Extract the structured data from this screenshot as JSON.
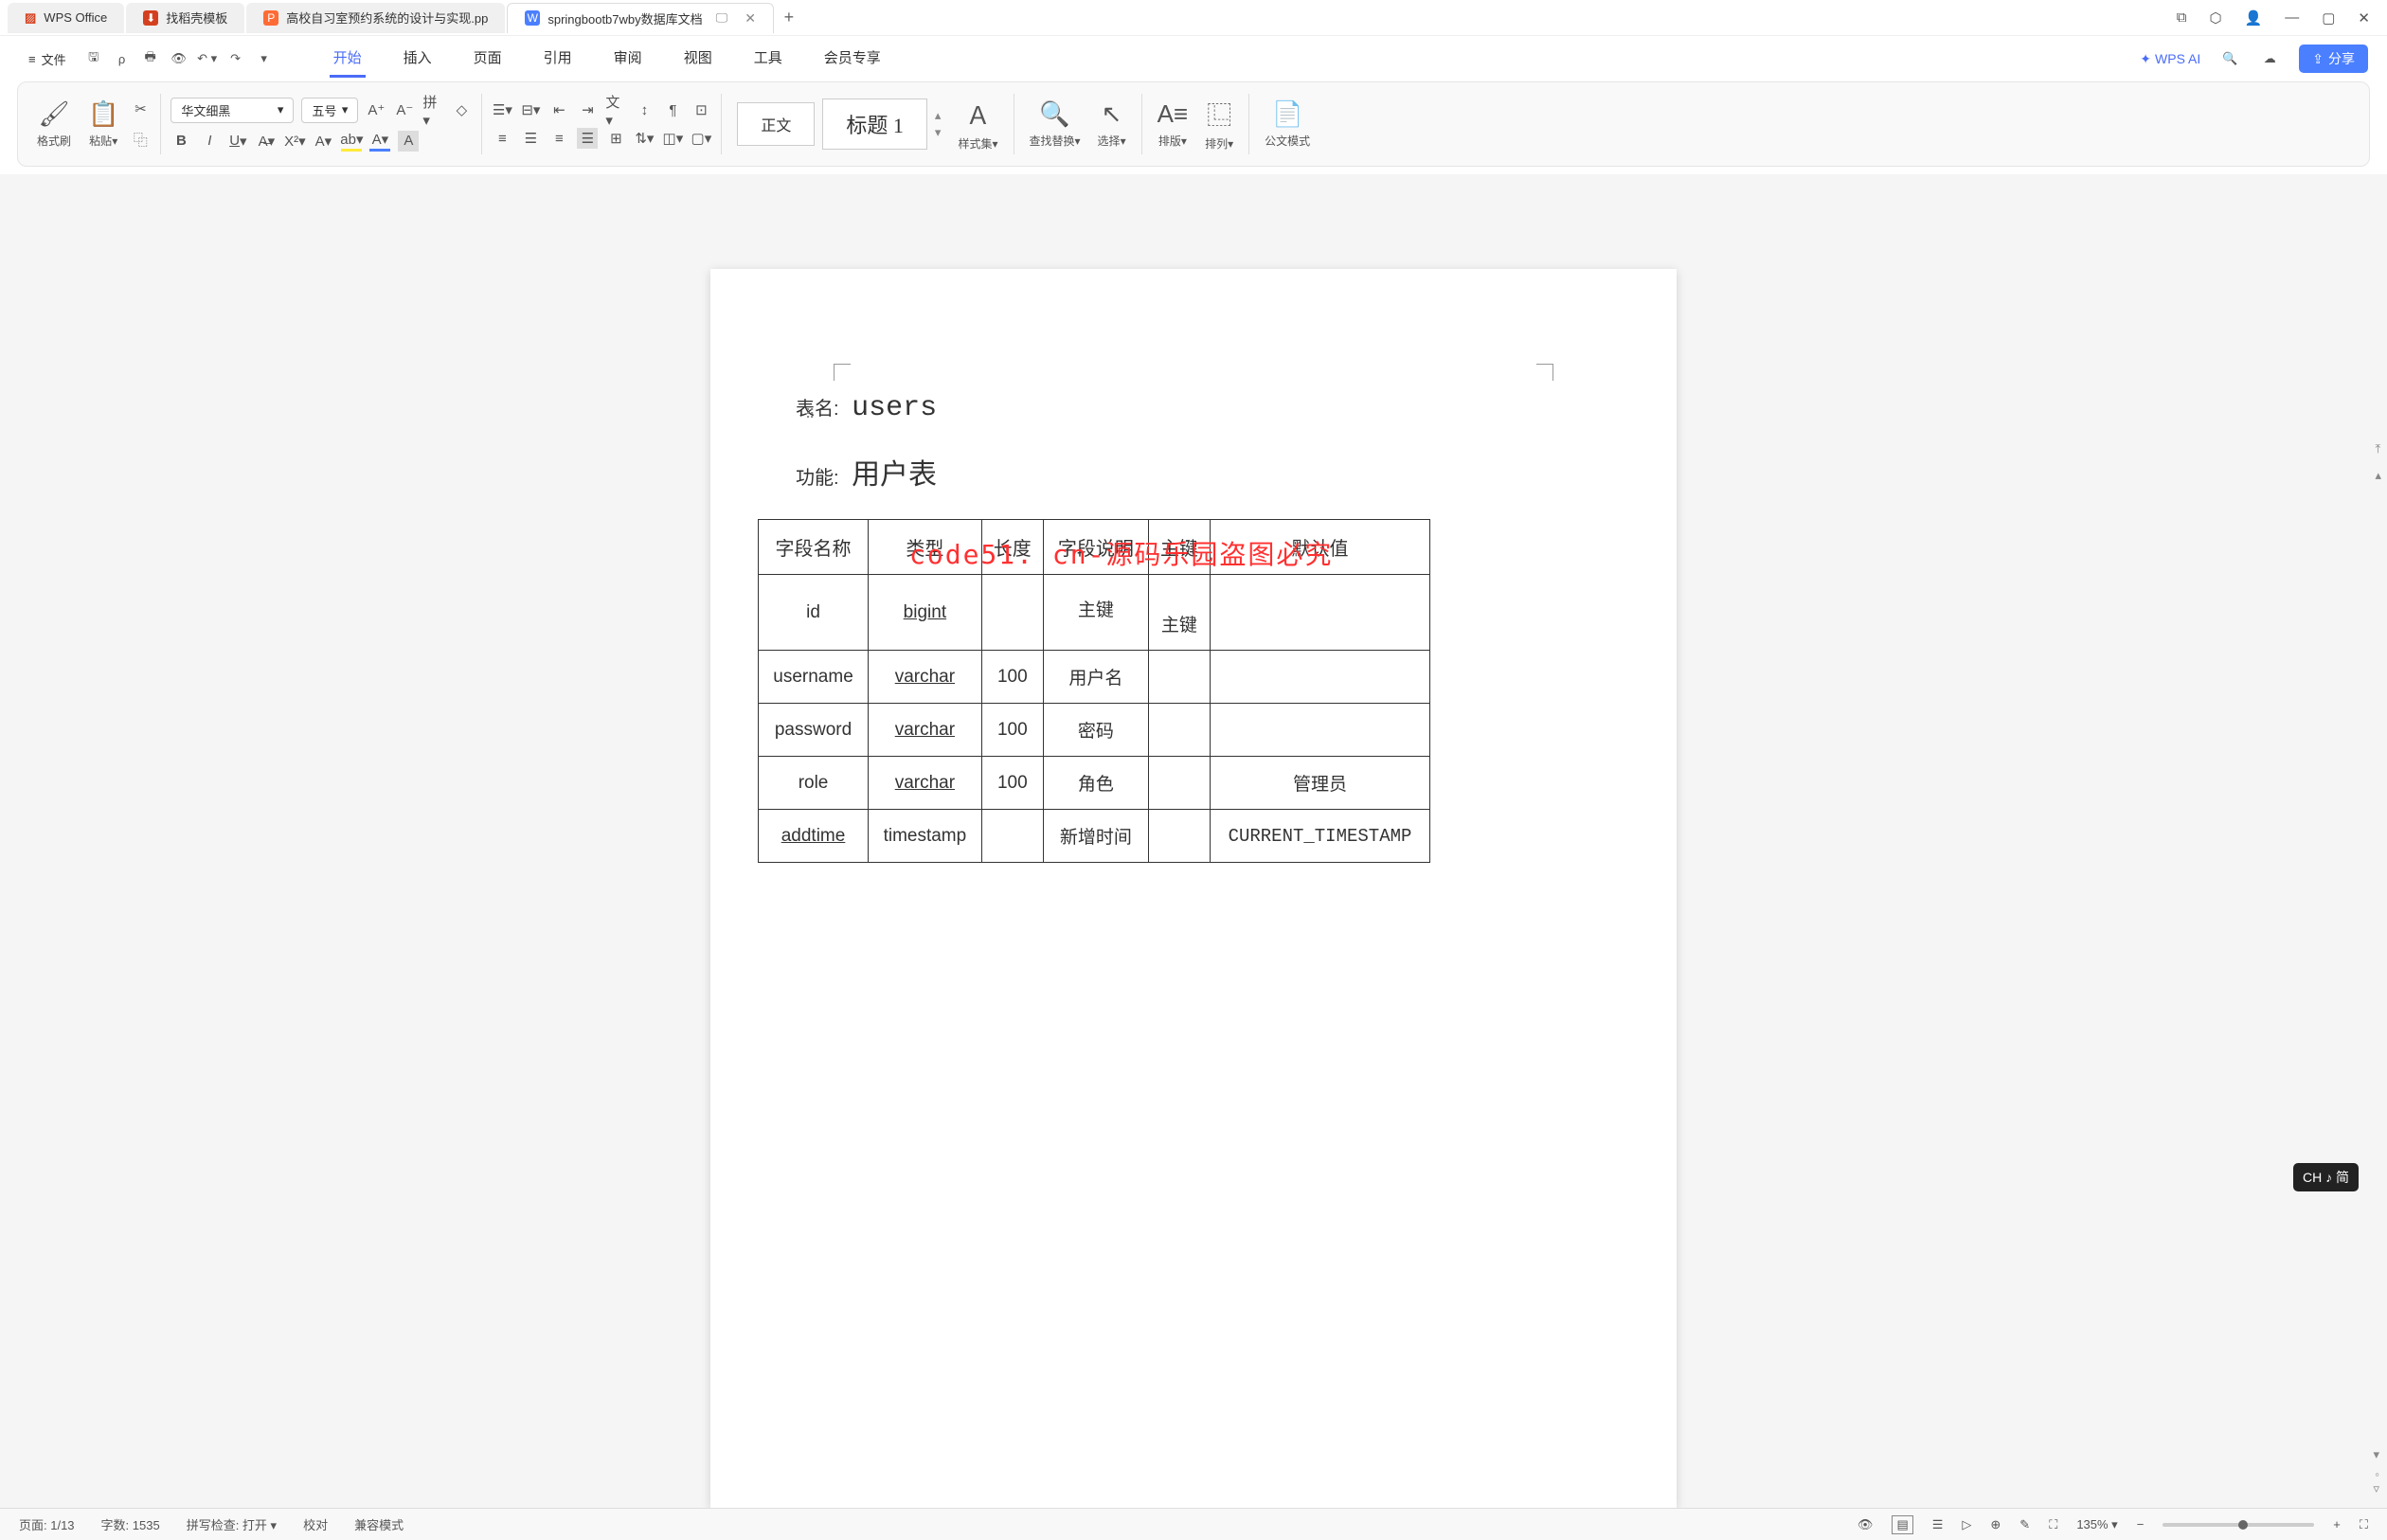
{
  "app_name": "WPS Office",
  "tabs": [
    {
      "label": "找稻壳模板",
      "icon_bg": "#d4401f"
    },
    {
      "label": "高校自习室预约系统的设计与实现.pp",
      "icon_bg": "#ff6b35",
      "icon_letter": "P"
    },
    {
      "label": "springbootb7wby数据库文档",
      "icon_bg": "#4a7fff",
      "icon_letter": "W",
      "active": true
    }
  ],
  "menubar": {
    "file": "文件",
    "tabs": [
      "开始",
      "插入",
      "页面",
      "引用",
      "审阅",
      "视图",
      "工具",
      "会员专享"
    ],
    "active_tab": "开始",
    "wps_ai": "WPS AI",
    "share": "分享"
  },
  "ribbon": {
    "format_painter": "格式刷",
    "paste": "粘贴",
    "font_name": "华文细黑",
    "font_size": "五号",
    "style_normal": "正文",
    "style_h1": "标题 1",
    "styleset": "样式集",
    "find_replace": "查找替换",
    "select": "选择",
    "layout": "排版",
    "arrange": "排列",
    "formula_mode": "公文模式"
  },
  "document": {
    "table_name_label": "表名:",
    "table_name_value": "users",
    "function_label": "功能:",
    "function_value": "用户表",
    "watermark": "code51. cn-源码乐园盗图必究",
    "headers": [
      "字段名称",
      "类型",
      "长度",
      "字段说明",
      "主键",
      "默认值"
    ],
    "rows": [
      {
        "field": "id",
        "type": "bigint",
        "length": "",
        "desc": "主键",
        "pk": "主键",
        "default": ""
      },
      {
        "field": "username",
        "type": "varchar",
        "length": "100",
        "desc": "用户名",
        "pk": "",
        "default": ""
      },
      {
        "field": "password",
        "type": "varchar",
        "length": "100",
        "desc": "密码",
        "pk": "",
        "default": ""
      },
      {
        "field": "role",
        "type": "varchar",
        "length": "100",
        "desc": "角色",
        "pk": "",
        "default": "管理员"
      },
      {
        "field": "addtime",
        "type": "timestamp",
        "length": "",
        "desc": "新增时间",
        "pk": "",
        "default": "CURRENT_TIMESTAMP"
      }
    ]
  },
  "statusbar": {
    "page": "页面: 1/13",
    "words": "字数: 1535",
    "spellcheck": "拼写检查: 打开",
    "proof": "校对",
    "compat": "兼容模式",
    "zoom": "135%"
  },
  "ime": "CH ♪ 简"
}
